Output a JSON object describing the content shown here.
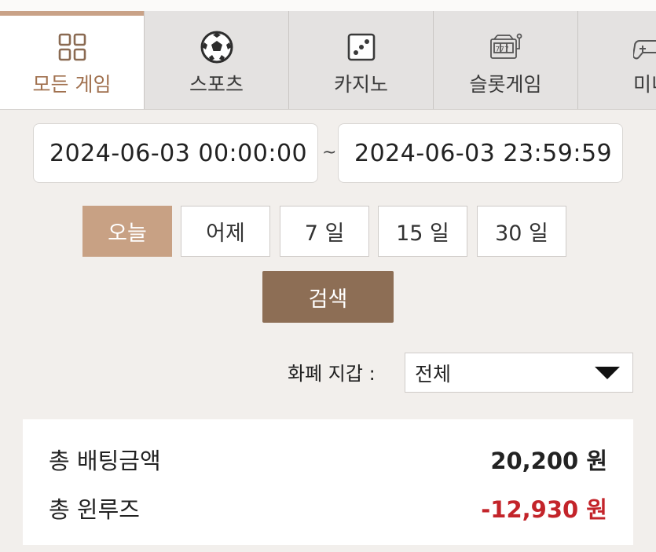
{
  "tabs": [
    {
      "label": "모든 게임",
      "icon": "grid-icon",
      "active": true
    },
    {
      "label": "스포츠",
      "icon": "soccer-ball-icon",
      "active": false
    },
    {
      "label": "카지노",
      "icon": "dice-icon",
      "active": false
    },
    {
      "label": "슬롯게임",
      "icon": "slot-machine-icon",
      "active": false
    },
    {
      "label": "미니",
      "icon": "gamepad-icon",
      "active": false
    }
  ],
  "date_range": {
    "start": "2024-06-03 00:00:00",
    "separator": "~",
    "end": "2024-06-03 23:59:59"
  },
  "quick_ranges": [
    {
      "label": "오늘",
      "active": true
    },
    {
      "label": "어제",
      "active": false
    },
    {
      "label": "7 일",
      "active": false
    },
    {
      "label": "15 일",
      "active": false
    },
    {
      "label": "30 일",
      "active": false
    }
  ],
  "search_label": "검색",
  "wallet": {
    "label": "화폐 지갑 :",
    "selected": "전체"
  },
  "summary": {
    "total_bet_label": "총 배팅금액",
    "total_bet_value": "20,200 원",
    "total_winloss_label": "총 윈루즈",
    "total_winloss_value": "-12,930 원"
  },
  "colors": {
    "accent": "#c8a184",
    "search_button": "#8d6e55",
    "negative": "#c3242a"
  }
}
